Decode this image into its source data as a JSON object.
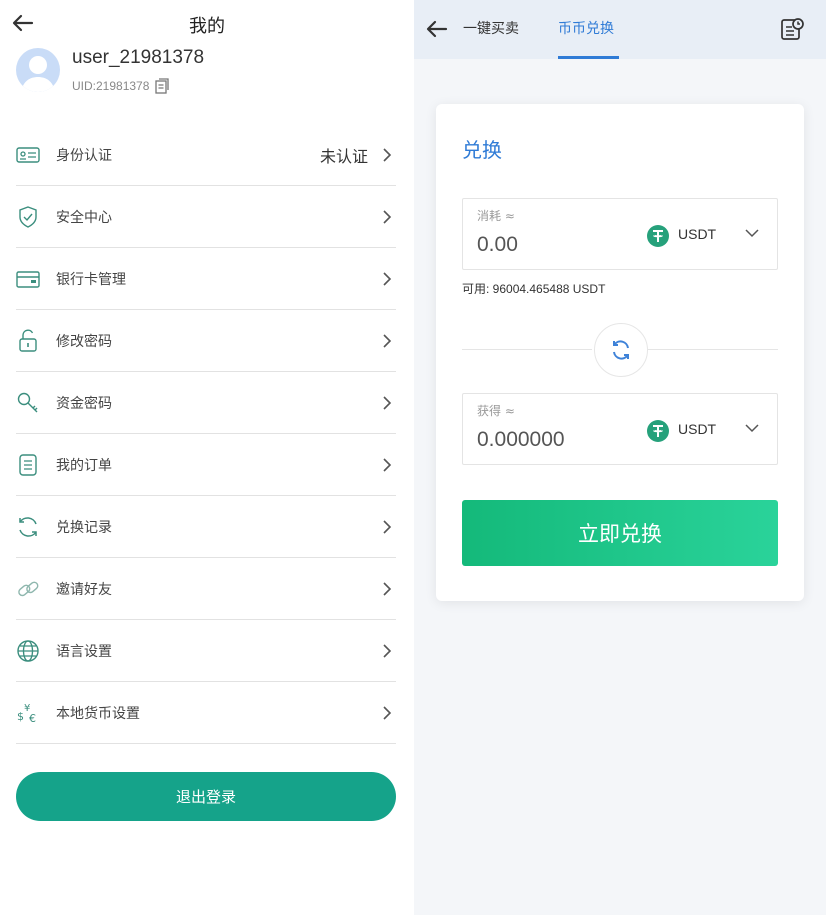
{
  "left": {
    "title": "我的",
    "username": "user_21981378",
    "uid": "UID:21981378",
    "menu": [
      {
        "label": "身份认证",
        "value": "未认证",
        "icon": "id-card-icon"
      },
      {
        "label": "安全中心",
        "value": "",
        "icon": "shield-icon"
      },
      {
        "label": "银行卡管理",
        "value": "",
        "icon": "bank-card-icon"
      },
      {
        "label": "修改密码",
        "value": "",
        "icon": "lock-icon"
      },
      {
        "label": "资金密码",
        "value": "",
        "icon": "key-icon"
      },
      {
        "label": "我的订单",
        "value": "",
        "icon": "order-icon"
      },
      {
        "label": "兑换记录",
        "value": "",
        "icon": "refresh-icon"
      },
      {
        "label": "邀请好友",
        "value": "",
        "icon": "link-icon"
      },
      {
        "label": "语言设置",
        "value": "",
        "icon": "globe-icon"
      },
      {
        "label": "本地货币设置",
        "value": "",
        "icon": "currency-icon"
      }
    ],
    "logout_label": "退出登录"
  },
  "right": {
    "tabs": [
      "一键买卖",
      "币币兑换"
    ],
    "active_tab": "币币兑换",
    "card_title": "兑换",
    "spend": {
      "caption": "消耗 ≈",
      "amount": "0.00",
      "coin": "USDT"
    },
    "available": "可用: 96004.465488 USDT",
    "receive": {
      "caption": "获得 ≈",
      "amount": "0.000000",
      "coin": "USDT"
    },
    "submit_label": "立即兑换"
  },
  "colors": {
    "accent_blue": "#2f7bd6",
    "teal": "#15a38a",
    "green_start": "#14b97a",
    "green_end": "#2ad39a",
    "usdt": "#26a17b"
  }
}
